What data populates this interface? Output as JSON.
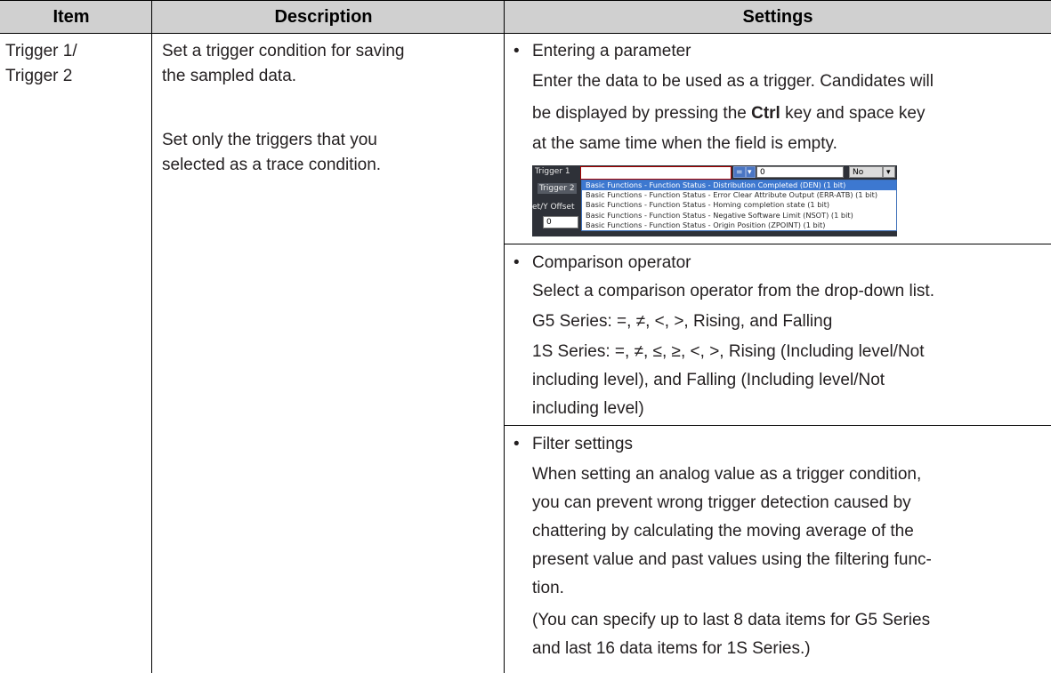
{
  "header": {
    "item": "Item",
    "description": "Description",
    "settings": "Settings"
  },
  "row": {
    "item_line1": "Trigger 1/",
    "item_line2": "Trigger 2",
    "desc_line1": "Set a trigger condition for saving",
    "desc_line2": "the sampled data.",
    "desc_line3": "Set only the triggers that you",
    "desc_line4": "selected as a trace condition.",
    "bullet": "•",
    "s1_title": "Entering a parameter",
    "s1_p1": "Enter the data to be used as a trigger. Candidates will",
    "s1_p2_a": "be displayed by pressing the ",
    "s1_p2_bold": "Ctrl",
    "s1_p2_b": " key and space key",
    "s1_p3": "at the same time when the field is empty.",
    "s2_title": "Comparison operator",
    "s2_p1": "Select a comparison operator from the drop-down list.",
    "s2_p2": "G5 Series: =, ≠, <, >, Rising, and Falling",
    "s2_p3": "1S Series: =, ≠, ≤, ≥, <, >, Rising (Including level/Not",
    "s2_p4": "including level), and Falling (Including level/Not",
    "s2_p5": "including level)",
    "s3_title": "Filter settings",
    "s3_p1": "When setting an analog value as a trigger condition,",
    "s3_p2": "you can prevent wrong trigger detection caused by",
    "s3_p3": "chattering by calculating the moving average of the",
    "s3_p4": "present value and past values using the filtering func-",
    "s3_p5": "tion.",
    "s3_p6": "(You can specify up to last 8 data items for G5 Series",
    "s3_p7": "and last 16 data items for 1S Series.)"
  },
  "screenshot": {
    "trigger1_label": "Trigger 1",
    "trigger2_label": "Trigger 2",
    "offset_label": "et/Y Offset",
    "operator_value": "=",
    "value_field": "0",
    "offset_value": "0",
    "filter_value": "No Filter",
    "candidates": [
      "Basic Functions - Function Status - Distribution Completed (DEN) (1 bit)",
      "Basic Functions - Function Status - Error Clear Attribute Output (ERR-ATB) (1 bit)",
      "Basic Functions - Function Status - Homing completion state (1 bit)",
      "Basic Functions - Function Status - Negative Software Limit (NSOT) (1 bit)",
      "Basic Functions - Function Status - Origin Position (ZPOINT) (1 bit)"
    ]
  }
}
